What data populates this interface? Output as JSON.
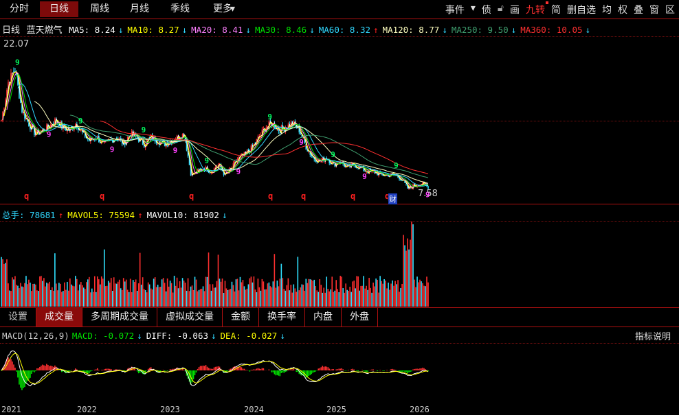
{
  "period_tabs": [
    "分时",
    "日线",
    "周线",
    "月线",
    "季线",
    "更多"
  ],
  "active_period": "日线",
  "right_menu": [
    "事件",
    "债",
    "画",
    "九转",
    "简",
    "删自选",
    "均",
    "权",
    "叠",
    "窗",
    "区"
  ],
  "ma_row": {
    "period": "日线",
    "stock_name": "蓝天燃气",
    "items": [
      {
        "label": "MA5: 8.24",
        "arrow": "↓",
        "color": "#ffffff",
        "dir": "dn"
      },
      {
        "label": "MA10: 8.27",
        "arrow": "↓",
        "color": "#ffff00",
        "dir": "dn"
      },
      {
        "label": "MA20: 8.41",
        "arrow": "↓",
        "color": "#ff80ff",
        "dir": "dn"
      },
      {
        "label": "MA30: 8.46",
        "arrow": "↓",
        "color": "#00e000",
        "dir": "dn"
      },
      {
        "label": "MA60: 8.32",
        "arrow": "↑",
        "color": "#30d8ff",
        "dir": "up"
      },
      {
        "label": "MA120: 8.77",
        "arrow": "↓",
        "color": "#ffffc0",
        "dir": "dn"
      },
      {
        "label": "MA250: 9.50",
        "arrow": "↓",
        "color": "#40a070",
        "dir": "dn"
      },
      {
        "label": "MA360: 10.05",
        "arrow": "↓",
        "color": "#ff3030",
        "dir": "dn"
      }
    ]
  },
  "price_labels": {
    "high": "22.07",
    "low": "7.58",
    "marker": "财"
  },
  "vol_row": {
    "items": [
      {
        "label": "总手: 78681",
        "arrow": "↑",
        "color": "#30d8ff",
        "dir": "up"
      },
      {
        "label": "MAVOL5: 75594",
        "arrow": "↑",
        "color": "#ffff00",
        "dir": "up"
      },
      {
        "label": "MAVOL10: 81902",
        "arrow": "↓",
        "color": "#ffffff",
        "dir": "dn"
      }
    ]
  },
  "indicator_tabs": [
    "设置",
    "成交量",
    "多周期成交量",
    "虚拟成交量",
    "金额",
    "换手率",
    "内盘",
    "外盘"
  ],
  "active_indicator": "成交量",
  "macd_row": {
    "items": [
      {
        "label": "MACD(12,26,9)",
        "arrow": "",
        "color": "#cccccc",
        "dir": ""
      },
      {
        "label": "MACD: -0.072",
        "arrow": "↓",
        "color": "#00e000",
        "dir": "dn"
      },
      {
        "label": "DIFF: -0.063",
        "arrow": "↓",
        "color": "#ffffff",
        "dir": "dn"
      },
      {
        "label": "DEA: -0.027",
        "arrow": "↓",
        "color": "#ffff00",
        "dir": "dn"
      }
    ]
  },
  "explain_label": "指标说明",
  "chart_data": {
    "type": "candlestick",
    "x_labels": [
      "2021",
      "2022",
      "2023",
      "2024",
      "2025",
      "2026"
    ],
    "y_range": [
      7.58,
      22.07
    ],
    "monthly_close_approx": [
      14.73,
      18.37,
      19.69,
      15.72,
      14.4,
      13.4,
      13.73,
      14.06,
      14.73,
      14.06,
      13.73,
      14.4,
      13.4,
      12.74,
      13.07,
      12.41,
      12.74,
      13.07,
      12.41,
      13.4,
      13.07,
      12.41,
      13.07,
      12.74,
      12.41,
      12.74,
      13.07,
      13.4,
      9.43,
      9.76,
      10.1,
      9.76,
      10.43,
      9.43,
      10.1,
      11.09,
      11.42,
      12.08,
      13.07,
      14.06,
      14.4,
      13.73,
      14.06,
      14.4,
      13.73,
      12.08,
      11.09,
      10.76,
      11.09,
      10.43,
      10.76,
      10.1,
      10.43,
      10.1,
      9.76,
      9.76,
      9.43,
      9.43,
      9.43,
      9.1,
      8.11,
      8.44,
      8.57,
      8.31
    ]
  }
}
